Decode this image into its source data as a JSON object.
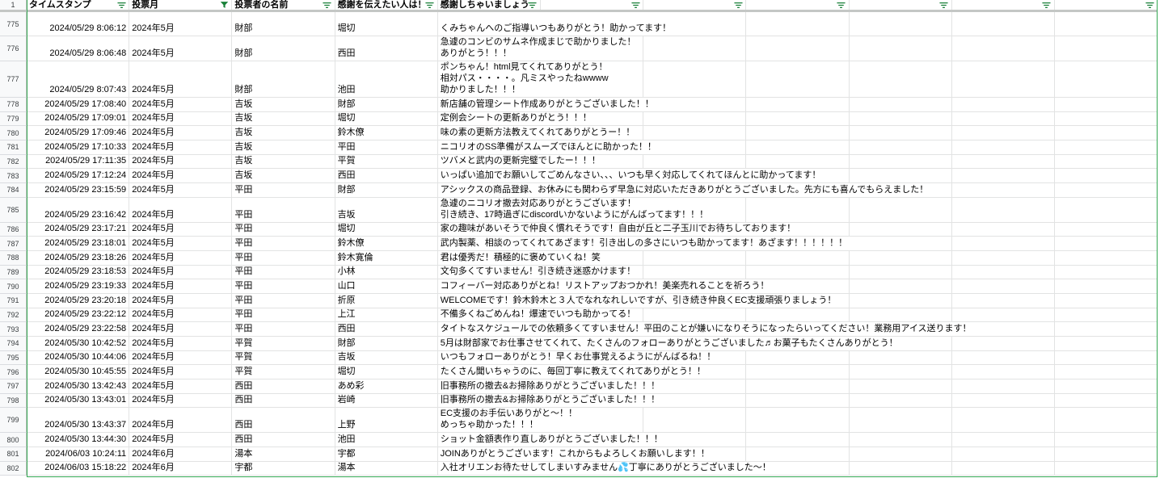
{
  "colors": {
    "gridline": "#e2e3e3",
    "filter_icon": "#188038",
    "filter_range_border": "#34a853"
  },
  "sheet": {
    "header_row_number": "1",
    "columns": [
      {
        "label": "タイムスタンプ",
        "filter_icon": "filter-icon"
      },
      {
        "label": "投票月",
        "filter_icon": "filter-active-icon"
      },
      {
        "label": "投票者の名前",
        "filter_icon": "filter-icon"
      },
      {
        "label": "感謝を伝えたい人は！",
        "filter_icon": "filter-icon"
      },
      {
        "label": "感謝しちゃいましょう",
        "filter_icon": "filter-icon"
      },
      {
        "filter_icon": "filter-icon"
      },
      {
        "filter_icon": "filter-icon"
      },
      {
        "filter_icon": "filter-icon"
      },
      {
        "filter_icon": "filter-icon"
      },
      {
        "filter_icon": "filter-icon"
      },
      {
        "filter_icon": "filter-icon"
      }
    ],
    "rows": [
      {
        "row_number": "775",
        "timestamp": "2024/05/29 8:06:12",
        "vote_month": "2024年5月",
        "voter": "財部",
        "recipient": "堀切",
        "message": "くみちゃんへのご指導いつもありがとう！助かってます！"
      },
      {
        "row_number": "776",
        "timestamp": "2024/05/29 8:06:48",
        "vote_month": "2024年5月",
        "voter": "財部",
        "recipient": "西田",
        "message": "急遽のコンビのサムネ作成まじで助かりました！\nありがとう！！！"
      },
      {
        "row_number": "777",
        "timestamp": "2024/05/29 8:07:43",
        "vote_month": "2024年5月",
        "voter": "財部",
        "recipient": "池田",
        "message": "ポンちゃん！html見てくれてありがとう！\n相対パス・・・・。凡ミスやったねwwww\n助かりました！！！"
      },
      {
        "row_number": "778",
        "timestamp": "2024/05/29 17:08:40",
        "vote_month": "2024年5月",
        "voter": "吉坂",
        "recipient": "財部",
        "message": "新店舗の管理シート作成ありがとうございました！！"
      },
      {
        "row_number": "779",
        "timestamp": "2024/05/29 17:09:01",
        "vote_month": "2024年5月",
        "voter": "吉坂",
        "recipient": "堀切",
        "message": "定例会シートの更新ありがとう！！！"
      },
      {
        "row_number": "780",
        "timestamp": "2024/05/29 17:09:46",
        "vote_month": "2024年5月",
        "voter": "吉坂",
        "recipient": "鈴木僚",
        "message": "味の素の更新方法教えてくれてありがとうー！！"
      },
      {
        "row_number": "781",
        "timestamp": "2024/05/29 17:10:33",
        "vote_month": "2024年5月",
        "voter": "吉坂",
        "recipient": "平田",
        "message": "ニコリオのSS準備がスムーズでほんとに助かった！！"
      },
      {
        "row_number": "782",
        "timestamp": "2024/05/29 17:11:35",
        "vote_month": "2024年5月",
        "voter": "吉坂",
        "recipient": "平賀",
        "message": "ツバメと武内の更新完璧でしたー！！！"
      },
      {
        "row_number": "783",
        "timestamp": "2024/05/29 17:12:24",
        "vote_month": "2024年5月",
        "voter": "吉坂",
        "recipient": "西田",
        "message": "いっぱい追加でお願いしてごめんなさい、、、いつも早く対応してくれてほんとに助かってます！"
      },
      {
        "row_number": "784",
        "timestamp": "2024/05/29 23:15:59",
        "vote_month": "2024年5月",
        "voter": "平田",
        "recipient": "財部",
        "message": "アシックスの商品登録、お休みにも関わらず早急に対応いただきありがとうございました。先方にも喜んでもらえました！"
      },
      {
        "row_number": "785",
        "timestamp": "2024/05/29 23:16:42",
        "vote_month": "2024年5月",
        "voter": "平田",
        "recipient": "吉坂",
        "message": "急遽のニコリオ撤去対応ありがとうございます！\n引き続き、17時過ぎにdiscordいかないようにがんばってます！！！"
      },
      {
        "row_number": "786",
        "timestamp": "2024/05/29 23:17:21",
        "vote_month": "2024年5月",
        "voter": "平田",
        "recipient": "堀切",
        "message": "家の趣味があいそうで仲良く慣れそうです！自由が丘と二子玉川でお待ちしております！"
      },
      {
        "row_number": "787",
        "timestamp": "2024/05/29 23:18:01",
        "vote_month": "2024年5月",
        "voter": "平田",
        "recipient": "鈴木僚",
        "message": "武内製薬、相談のってくれてあざます！引き出しの多さにいつも助かってます！あざます！！！！！！"
      },
      {
        "row_number": "788",
        "timestamp": "2024/05/29 23:18:26",
        "vote_month": "2024年5月",
        "voter": "平田",
        "recipient": "鈴木寛倫",
        "message": "君は優秀だ！積極的に褒めていくね！笑"
      },
      {
        "row_number": "789",
        "timestamp": "2024/05/29 23:18:53",
        "vote_month": "2024年5月",
        "voter": "平田",
        "recipient": "小林",
        "message": "文句多くてすいません！引き続き迷惑かけます！"
      },
      {
        "row_number": "790",
        "timestamp": "2024/05/29 23:19:33",
        "vote_month": "2024年5月",
        "voter": "平田",
        "recipient": "山口",
        "message": "コフィーバー対応ありがとね！リストアップおつかれ！美楽売れることを祈ろう！"
      },
      {
        "row_number": "791",
        "timestamp": "2024/05/29 23:20:18",
        "vote_month": "2024年5月",
        "voter": "平田",
        "recipient": "折原",
        "message": "WELCOMEです！鈴木鈴木と３人でなれなれしいですが、引き続き仲良くEC支援頑張りましょう！"
      },
      {
        "row_number": "792",
        "timestamp": "2024/05/29 23:22:12",
        "vote_month": "2024年5月",
        "voter": "平田",
        "recipient": "上江",
        "message": "不備多くねごめんね！爆速でいつも助かってる！"
      },
      {
        "row_number": "793",
        "timestamp": "2024/05/29 23:22:58",
        "vote_month": "2024年5月",
        "voter": "平田",
        "recipient": "西田",
        "message": "タイトなスケジュールでの依頼多くてすいません！平田のことが嫌いになりそうになったらいってください！業務用アイス送ります！"
      },
      {
        "row_number": "794",
        "timestamp": "2024/05/30 10:42:52",
        "vote_month": "2024年5月",
        "voter": "平賀",
        "recipient": "財部",
        "message": "5月は財部家でお仕事させてくれて、たくさんのフォローありがとうございました♬お菓子もたくさんありがとう！"
      },
      {
        "row_number": "795",
        "timestamp": "2024/05/30 10:44:06",
        "vote_month": "2024年5月",
        "voter": "平賀",
        "recipient": "吉坂",
        "message": "いつもフォローありがとう！早くお仕事覚えるようにがんばるね！！"
      },
      {
        "row_number": "796",
        "timestamp": "2024/05/30 10:45:55",
        "vote_month": "2024年5月",
        "voter": "平賀",
        "recipient": "堀切",
        "message": "たくさん聞いちゃうのに、毎回丁寧に教えてくれてありがとう！！"
      },
      {
        "row_number": "797",
        "timestamp": "2024/05/30 13:42:43",
        "vote_month": "2024年5月",
        "voter": "西田",
        "recipient": "あめ彩",
        "message": "旧事務所の撤去&お掃除ありがとうございました！！！"
      },
      {
        "row_number": "798",
        "timestamp": "2024/05/30 13:43:01",
        "vote_month": "2024年5月",
        "voter": "西田",
        "recipient": "岩崎",
        "message": "旧事務所の撤去&お掃除ありがとうございました！！！"
      },
      {
        "row_number": "799",
        "timestamp": "2024/05/30 13:43:37",
        "vote_month": "2024年5月",
        "voter": "西田",
        "recipient": "上野",
        "message": "EC支援のお手伝いありがと～！！\nめっちゃ助かった！！！"
      },
      {
        "row_number": "800",
        "timestamp": "2024/05/30 13:44:30",
        "vote_month": "2024年5月",
        "voter": "西田",
        "recipient": "池田",
        "message": "ショット金額表作り直しありがとうございました！！！"
      },
      {
        "row_number": "801",
        "timestamp": "2024/06/03 10:24:11",
        "vote_month": "2024年6月",
        "voter": "湯本",
        "recipient": "宇都",
        "message": "JOINありがとうございます！これからもよろしくお願いします！！"
      },
      {
        "row_number": "802",
        "timestamp": "2024/06/03 15:18:22",
        "vote_month": "2024年6月",
        "voter": "宇都",
        "recipient": "湯本",
        "message": "入社オリエンお待たせしてしまいすみません💦丁寧にありがとうございました～！"
      }
    ]
  }
}
